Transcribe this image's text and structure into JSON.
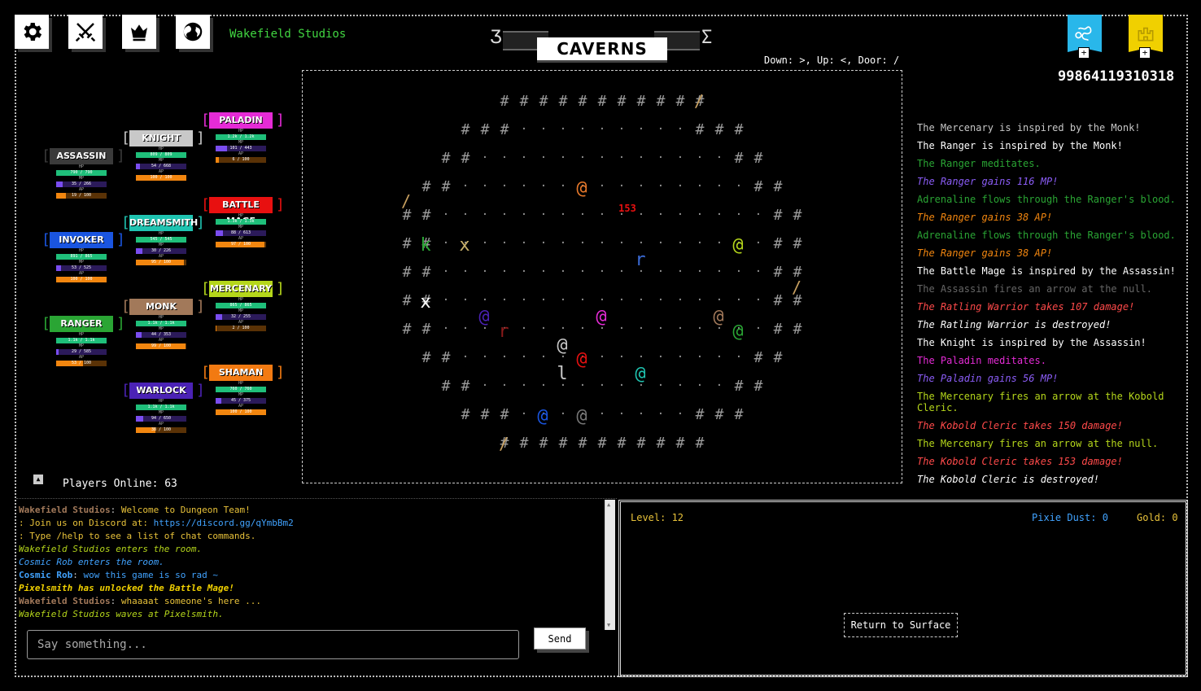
{
  "header": {
    "icons": [
      "gear-icon",
      "crossed-swords-icon",
      "crown-icon",
      "globe-icon"
    ],
    "studio_name": "Wakefield Studios",
    "zone_name": "CAVERNS",
    "controls_hint": "Down: >, Up: <, Door: /",
    "score": "99864119310318",
    "flags": [
      {
        "icon": "scroll-banner-icon",
        "color": "#29b7ea"
      },
      {
        "icon": "castle-banner-icon",
        "color": "#f0d000"
      }
    ],
    "plus_label": "+"
  },
  "classes": [
    {
      "name": "ASSASSIN",
      "color": "#3a3a3a",
      "hp": "790 / 790",
      "mp": "35 / 266",
      "ap": "19 / 100",
      "hp_frac": 1.0,
      "mp_frac": 0.13,
      "ap_frac": 0.19
    },
    {
      "name": "KNIGHT",
      "color": "#c8c8c8",
      "hp": "809 / 809",
      "mp": "54 / 668",
      "ap": "100 / 100",
      "hp_frac": 1.0,
      "mp_frac": 0.08,
      "ap_frac": 1.0
    },
    {
      "name": "PALADIN",
      "color": "#e52bd6",
      "hp": "1.2k / 1.2k",
      "mp": "101 / 443",
      "ap": "6 / 100",
      "hp_frac": 1.0,
      "mp_frac": 0.23,
      "ap_frac": 0.06
    },
    {
      "name": "DREAMSMITH",
      "color": "#1fc3b0",
      "hp": "545 / 545",
      "mp": "30 / 226",
      "ap": "95 / 100",
      "hp_frac": 1.0,
      "mp_frac": 0.13,
      "ap_frac": 0.95
    },
    {
      "name": "BATTLE MAGE",
      "color": "#e81010",
      "hp": "1.3k / 1.3k",
      "mp": "88 / 613",
      "ap": "97 / 100",
      "hp_frac": 1.0,
      "mp_frac": 0.14,
      "ap_frac": 0.97
    },
    {
      "name": "INVOKER",
      "color": "#1a55e0",
      "hp": "891 / 865",
      "mp": "53 / 525",
      "ap": "100 / 100",
      "hp_frac": 1.0,
      "mp_frac": 0.1,
      "ap_frac": 1.0
    },
    {
      "name": "MONK",
      "color": "#a2795a",
      "hp": "1.1k / 1.1k",
      "mp": "44 / 353",
      "ap": "99 / 100",
      "hp_frac": 1.0,
      "mp_frac": 0.12,
      "ap_frac": 0.99
    },
    {
      "name": "MERCENARY",
      "color": "#b5d61b",
      "hp": "865 / 865",
      "mp": "32 / 255",
      "ap": "2 / 100",
      "hp_frac": 1.0,
      "mp_frac": 0.13,
      "ap_frac": 0.02
    },
    {
      "name": "RANGER",
      "color": "#2aa534",
      "hp": "1.1k / 1.1k",
      "mp": "29 / 585",
      "ap": "53 / 100",
      "hp_frac": 1.0,
      "mp_frac": 0.05,
      "ap_frac": 0.53
    },
    {
      "name": "SHAMAN",
      "color": "#f27a12",
      "hp": "760 / 760",
      "mp": "45 / 375",
      "ap": "100 / 100",
      "hp_frac": 1.0,
      "mp_frac": 0.12,
      "ap_frac": 1.0
    },
    {
      "name": "WARLOCK",
      "color": "#4b22b5",
      "hp": "1.1k / 1.1k",
      "mp": "94 / 650",
      "ap": "38 / 100",
      "hp_frac": 1.0,
      "mp_frac": 0.14,
      "ap_frac": 0.38
    }
  ],
  "stat_labels": {
    "hp": "HP",
    "mp": "MP",
    "ap": "AP"
  },
  "bar_colors": {
    "hp": "#1fbf7a",
    "mp": "#7a4df0",
    "ap": "#f2860f",
    "track_hp": "#0d4f33",
    "track_mp": "#2b1a5a",
    "track_ap": "#5a3206"
  },
  "players_online": "Players Online: 63",
  "map": {
    "damage_text": "153",
    "entities": [
      {
        "ch": "@",
        "color": "#e8792b"
      },
      {
        "ch": "@",
        "color": "#b5d61b"
      },
      {
        "ch": "k",
        "color": "#2aa534"
      },
      {
        "ch": "x",
        "color": "#c8b06a"
      },
      {
        "ch": "r",
        "color": "#3b6bd6"
      },
      {
        "ch": "x",
        "color": "#ffffff"
      },
      {
        "ch": "@",
        "color": "#4b22b5"
      },
      {
        "ch": "r",
        "color": "#8a1a1a"
      },
      {
        "ch": "@",
        "color": "#e52bd6"
      },
      {
        "ch": "@",
        "color": "#a2795a"
      },
      {
        "ch": "@",
        "color": "#2aa534"
      },
      {
        "ch": "@",
        "color": "#c8c8c8"
      },
      {
        "ch": "@",
        "color": "#e81010"
      },
      {
        "ch": "l",
        "color": "#c8c8c8"
      },
      {
        "ch": "@",
        "color": "#1fc3b0"
      },
      {
        "ch": "@",
        "color": "#1a55e0"
      },
      {
        "ch": "@",
        "color": "#777777"
      }
    ]
  },
  "combat_log": [
    {
      "text": "The Mercenary is inspired by the Monk!",
      "color": "#c8c8c8",
      "italic": false
    },
    {
      "text": "The Ranger is inspired by the Monk!",
      "color": "#ffffff",
      "italic": false
    },
    {
      "text": "The Ranger meditates.",
      "color": "#2aa534",
      "italic": false
    },
    {
      "text": "The Ranger gains 116 MP!",
      "color": "#8a5cf5",
      "italic": true
    },
    {
      "text": "Adrenaline flows through the Ranger's blood.",
      "color": "#2aa534",
      "italic": false
    },
    {
      "text": "The Ranger gains 38 AP!",
      "color": "#f2860f",
      "italic": true
    },
    {
      "text": "Adrenaline flows through the Ranger's blood.",
      "color": "#2aa534",
      "italic": false
    },
    {
      "text": "The Ranger gains 38 AP!",
      "color": "#f2860f",
      "italic": true
    },
    {
      "text": "The Battle Mage is inspired by the Assassin!",
      "color": "#ffffff",
      "italic": false
    },
    {
      "text": "The Assassin fires an arrow at the null.",
      "color": "#666666",
      "italic": false
    },
    {
      "text": "The Ratling Warrior takes 107 damage!",
      "color": "#ff4a4a",
      "italic": true
    },
    {
      "text": "The Ratling Warrior is destroyed!",
      "color": "#ffffff",
      "italic": true
    },
    {
      "text": "The Knight is inspired by the Assassin!",
      "color": "#ffffff",
      "italic": false
    },
    {
      "text": "The Paladin meditates.",
      "color": "#e52bd6",
      "italic": false
    },
    {
      "text": "The Paladin gains 56 MP!",
      "color": "#8a5cf5",
      "italic": true
    },
    {
      "text": "The Mercenary fires an arrow at the Kobold Cleric.",
      "color": "#b5d61b",
      "italic": false
    },
    {
      "text": "The Kobold Cleric takes 150 damage!",
      "color": "#ff4a4a",
      "italic": true
    },
    {
      "text": "The Mercenary fires an arrow at the null.",
      "color": "#b5d61b",
      "italic": false
    },
    {
      "text": "The Kobold Cleric takes 153 damage!",
      "color": "#ff4a4a",
      "italic": true
    },
    {
      "text": "The Kobold Cleric is destroyed!",
      "color": "#ffffff",
      "italic": true
    }
  ],
  "chat": {
    "messages": [
      {
        "speaker": "Wakefield Studios",
        "text": "Welcome to Dungeon Team!",
        "speaker_color": "#a2795a",
        "text_color": "#e8c23a",
        "italic": false
      },
      {
        "speaker": "",
        "text": ": Join us on Discord at: ",
        "link": "https://discord.gg/qYmbBm2",
        "speaker_color": "#e8c23a",
        "text_color": "#e8c23a",
        "italic": false
      },
      {
        "speaker": "",
        "text": ": Type /help to see a list of chat commands.",
        "speaker_color": "#e8c23a",
        "text_color": "#e8c23a",
        "italic": false
      },
      {
        "speaker": "",
        "text": " Wakefield Studios enters the room.",
        "speaker_color": "#b5d61b",
        "text_color": "#b5d61b",
        "italic": true
      },
      {
        "speaker": "",
        "text": " Cosmic Rob enters the room.",
        "speaker_color": "#41a3ff",
        "text_color": "#41a3ff",
        "italic": true
      },
      {
        "speaker": "Cosmic Rob",
        "text": "wow this game is so rad ~",
        "speaker_color": "#41a3ff",
        "text_color": "#41a3ff",
        "italic": false
      },
      {
        "speaker": "",
        "text": " Pixelsmith has unlocked the Battle Mage!",
        "speaker_color": "#f0d000",
        "text_color": "#f0d000",
        "italic": true,
        "bold": true
      },
      {
        "speaker": "Wakefield Studios",
        "text": "whaaaat someone's here ...",
        "speaker_color": "#a2795a",
        "text_color": "#e8c23a",
        "italic": false
      },
      {
        "speaker": "",
        "text": " Wakefield Studios waves at Pixelsmith.",
        "speaker_color": "#b5d61b",
        "text_color": "#b5d61b",
        "italic": true
      }
    ],
    "input_placeholder": "Say something...",
    "send_label": "Send"
  },
  "status": {
    "level": "Level: 12",
    "pixie_dust": "Pixie Dust: 0",
    "gold": "Gold: 0",
    "return_label": "Return to Surface"
  }
}
